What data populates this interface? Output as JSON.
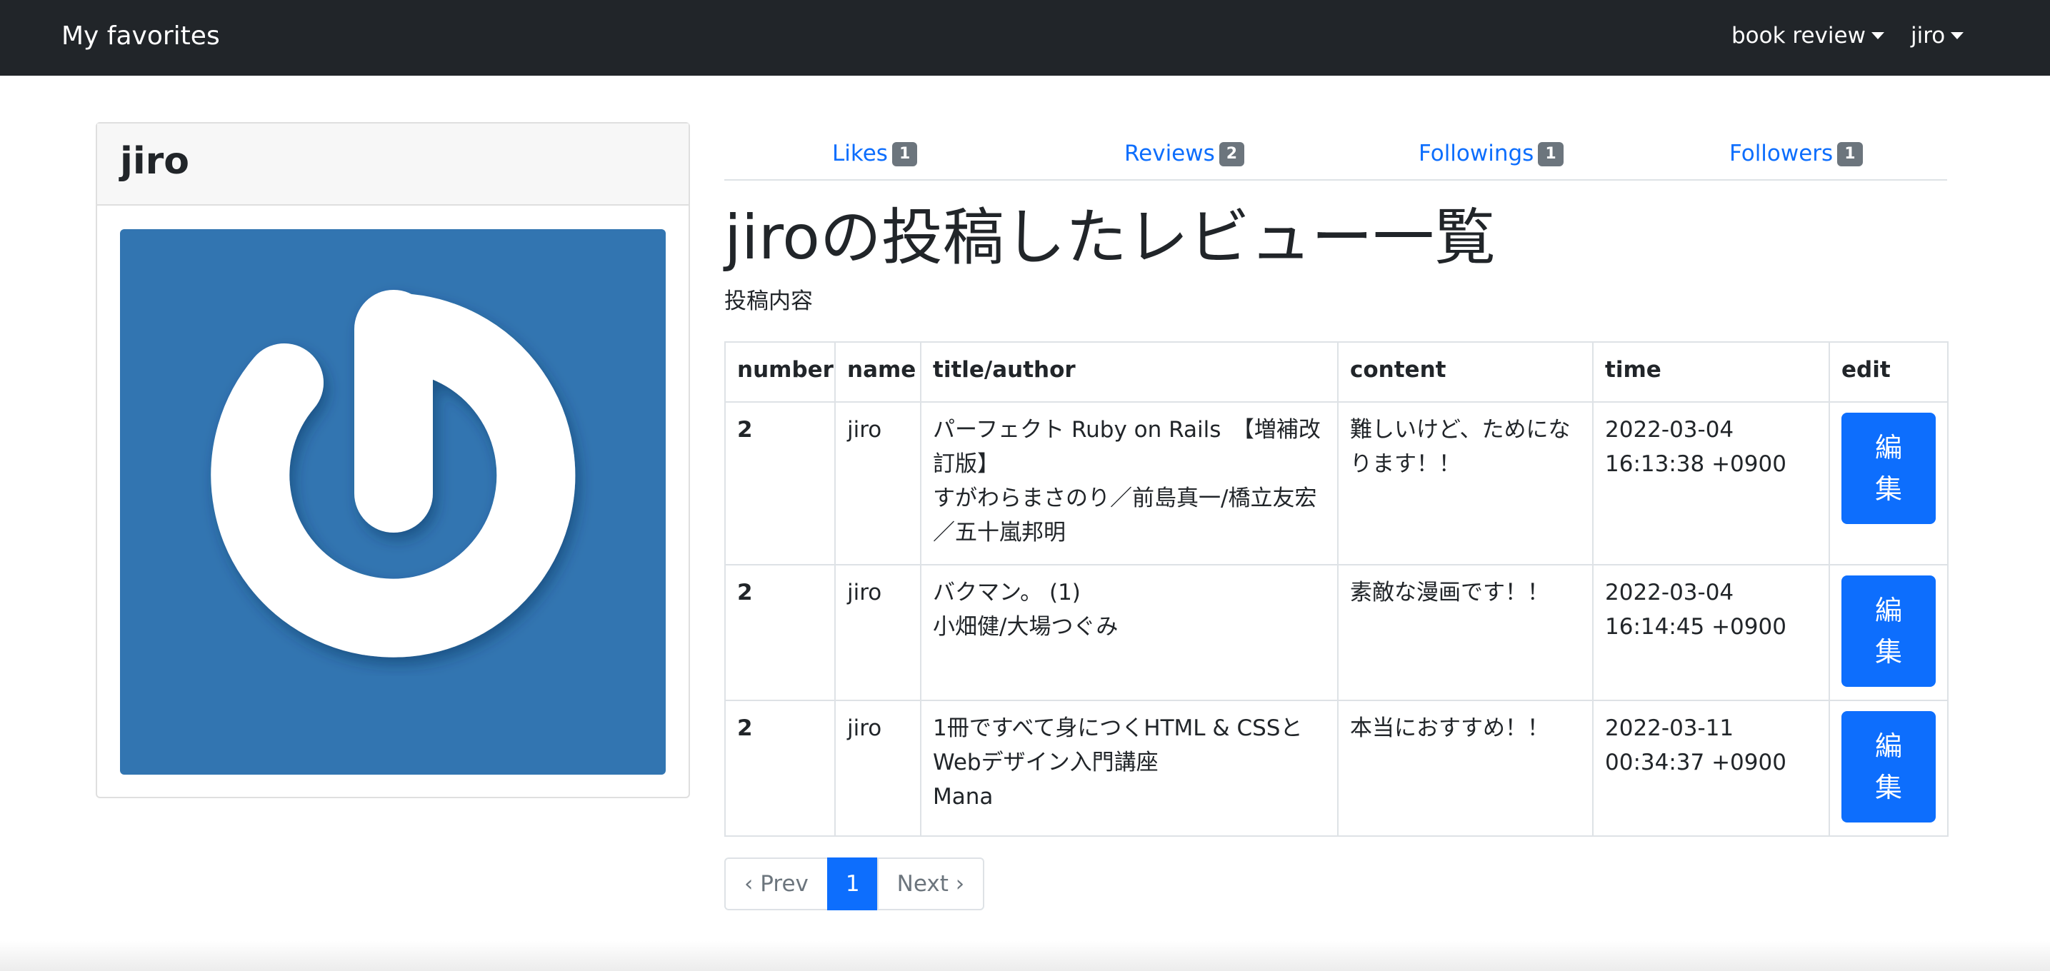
{
  "navbar": {
    "brand": "My favorites",
    "book_review": "book review",
    "user": "jiro"
  },
  "profile": {
    "name": "jiro",
    "avatar_color": "#3275b1"
  },
  "tabs": [
    {
      "label": "Likes",
      "count": "1"
    },
    {
      "label": "Reviews",
      "count": "2"
    },
    {
      "label": "Followings",
      "count": "1"
    },
    {
      "label": "Followers",
      "count": "1"
    }
  ],
  "main": {
    "heading": "jiroの投稿したレビュー一覧",
    "subheading": "投稿内容"
  },
  "table": {
    "headers": [
      "number",
      "name",
      "title/author",
      "content",
      "time",
      "edit"
    ],
    "rows": [
      {
        "number": "2",
        "name": "jiro",
        "title": "パーフェクト Ruby on Rails　【増補改訂版】",
        "author": "すがわらまさのり／前島真一/橋立友宏／五十嵐邦明",
        "content": "難しいけど、ためになります！！",
        "date": "2022-03-04",
        "clock": "16:13:38 +0900",
        "edit": "編集"
      },
      {
        "number": "2",
        "name": "jiro",
        "title": "バクマン。 (1)",
        "author": "小畑健/大場つぐみ",
        "content": "素敵な漫画です！！",
        "date": "2022-03-04",
        "clock": "16:14:45 +0900",
        "edit": "編集"
      },
      {
        "number": "2",
        "name": "jiro",
        "title": "1冊ですべて身につくHTML & CSSとWebデザイン入門講座",
        "author": "Mana",
        "content": "本当におすすめ！！",
        "date": "2022-03-11",
        "clock": "00:34:37 +0900",
        "edit": "編集"
      }
    ]
  },
  "pagination": {
    "prev": "‹ Prev",
    "current": "1",
    "next": "Next ›"
  },
  "colors": {
    "navbar": "#212529",
    "primary": "#0d6efd",
    "badge": "#6c757d"
  }
}
